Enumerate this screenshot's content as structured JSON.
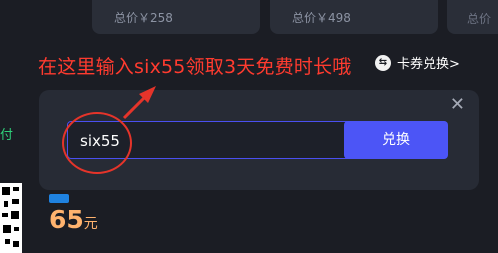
{
  "cards": [
    {
      "price_text": "总价￥258"
    },
    {
      "price_text": "总价￥498"
    },
    {
      "price_text": "总价"
    }
  ],
  "annotation": "在这里输入six55领取3天免费时长哦",
  "coupon_link": "卡券兑换>",
  "left_edge_text": "付",
  "redeem": {
    "input_value": "six55",
    "button_label": "兑换"
  },
  "plan": {
    "price": "65",
    "unit": "元"
  },
  "colors": {
    "accent": "#4c55f6",
    "annotation": "#ff3b2f",
    "price": "#ffb36e",
    "background": "#1b1d24"
  }
}
